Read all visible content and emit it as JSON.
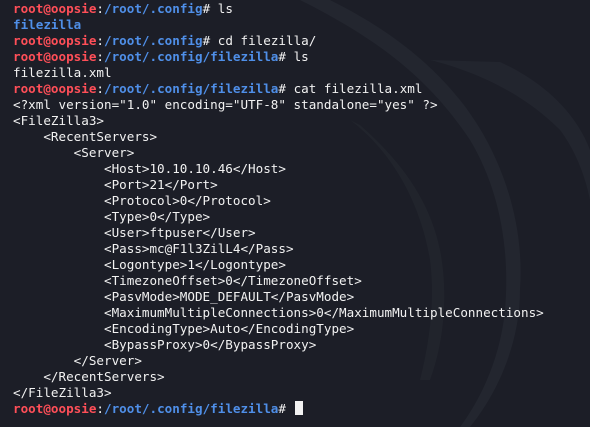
{
  "prompt": {
    "user_host": "root@oopsie",
    "colon": ":",
    "hash": "# "
  },
  "lines": [
    {
      "type": "prompt",
      "path": "/root/.config",
      "command": "ls"
    },
    {
      "type": "dir",
      "text": "filezilla"
    },
    {
      "type": "prompt",
      "path": "/root/.config",
      "command": "cd filezilla/"
    },
    {
      "type": "prompt",
      "path": "/root/.config/filezilla",
      "command": "ls"
    },
    {
      "type": "out",
      "text": "filezilla.xml"
    },
    {
      "type": "prompt",
      "path": "/root/.config/filezilla",
      "command": "cat filezilla.xml"
    },
    {
      "type": "out",
      "text": "<?xml version=\"1.0\" encoding=\"UTF-8\" standalone=\"yes\" ?>"
    },
    {
      "type": "out",
      "text": "<FileZilla3>"
    },
    {
      "type": "out",
      "text": "    <RecentServers>"
    },
    {
      "type": "out",
      "text": "        <Server>"
    },
    {
      "type": "out",
      "text": "            <Host>10.10.10.46</Host>"
    },
    {
      "type": "out",
      "text": "            <Port>21</Port>"
    },
    {
      "type": "out",
      "text": "            <Protocol>0</Protocol>"
    },
    {
      "type": "out",
      "text": "            <Type>0</Type>"
    },
    {
      "type": "out",
      "text": "            <User>ftpuser</User>"
    },
    {
      "type": "out",
      "text": "            <Pass>mc@F1l3ZilL4</Pass>"
    },
    {
      "type": "out",
      "text": "            <Logontype>1</Logontype>"
    },
    {
      "type": "out",
      "text": "            <TimezoneOffset>0</TimezoneOffset>"
    },
    {
      "type": "out",
      "text": "            <PasvMode>MODE_DEFAULT</PasvMode>"
    },
    {
      "type": "out",
      "text": "            <MaximumMultipleConnections>0</MaximumMultipleConnections>"
    },
    {
      "type": "out",
      "text": "            <EncodingType>Auto</EncodingType>"
    },
    {
      "type": "out",
      "text": "            <BypassProxy>0</BypassProxy>"
    },
    {
      "type": "out",
      "text": "        </Server>"
    },
    {
      "type": "out",
      "text": "    </RecentServers>"
    },
    {
      "type": "out",
      "text": "</FileZilla3>"
    },
    {
      "type": "prompt",
      "path": "/root/.config/filezilla",
      "command": "",
      "cursor": true
    }
  ],
  "colors": {
    "background": "#1c1e27",
    "user_host": "#ff4f58",
    "path": "#4f8fe8",
    "text": "#f2f2f2"
  }
}
